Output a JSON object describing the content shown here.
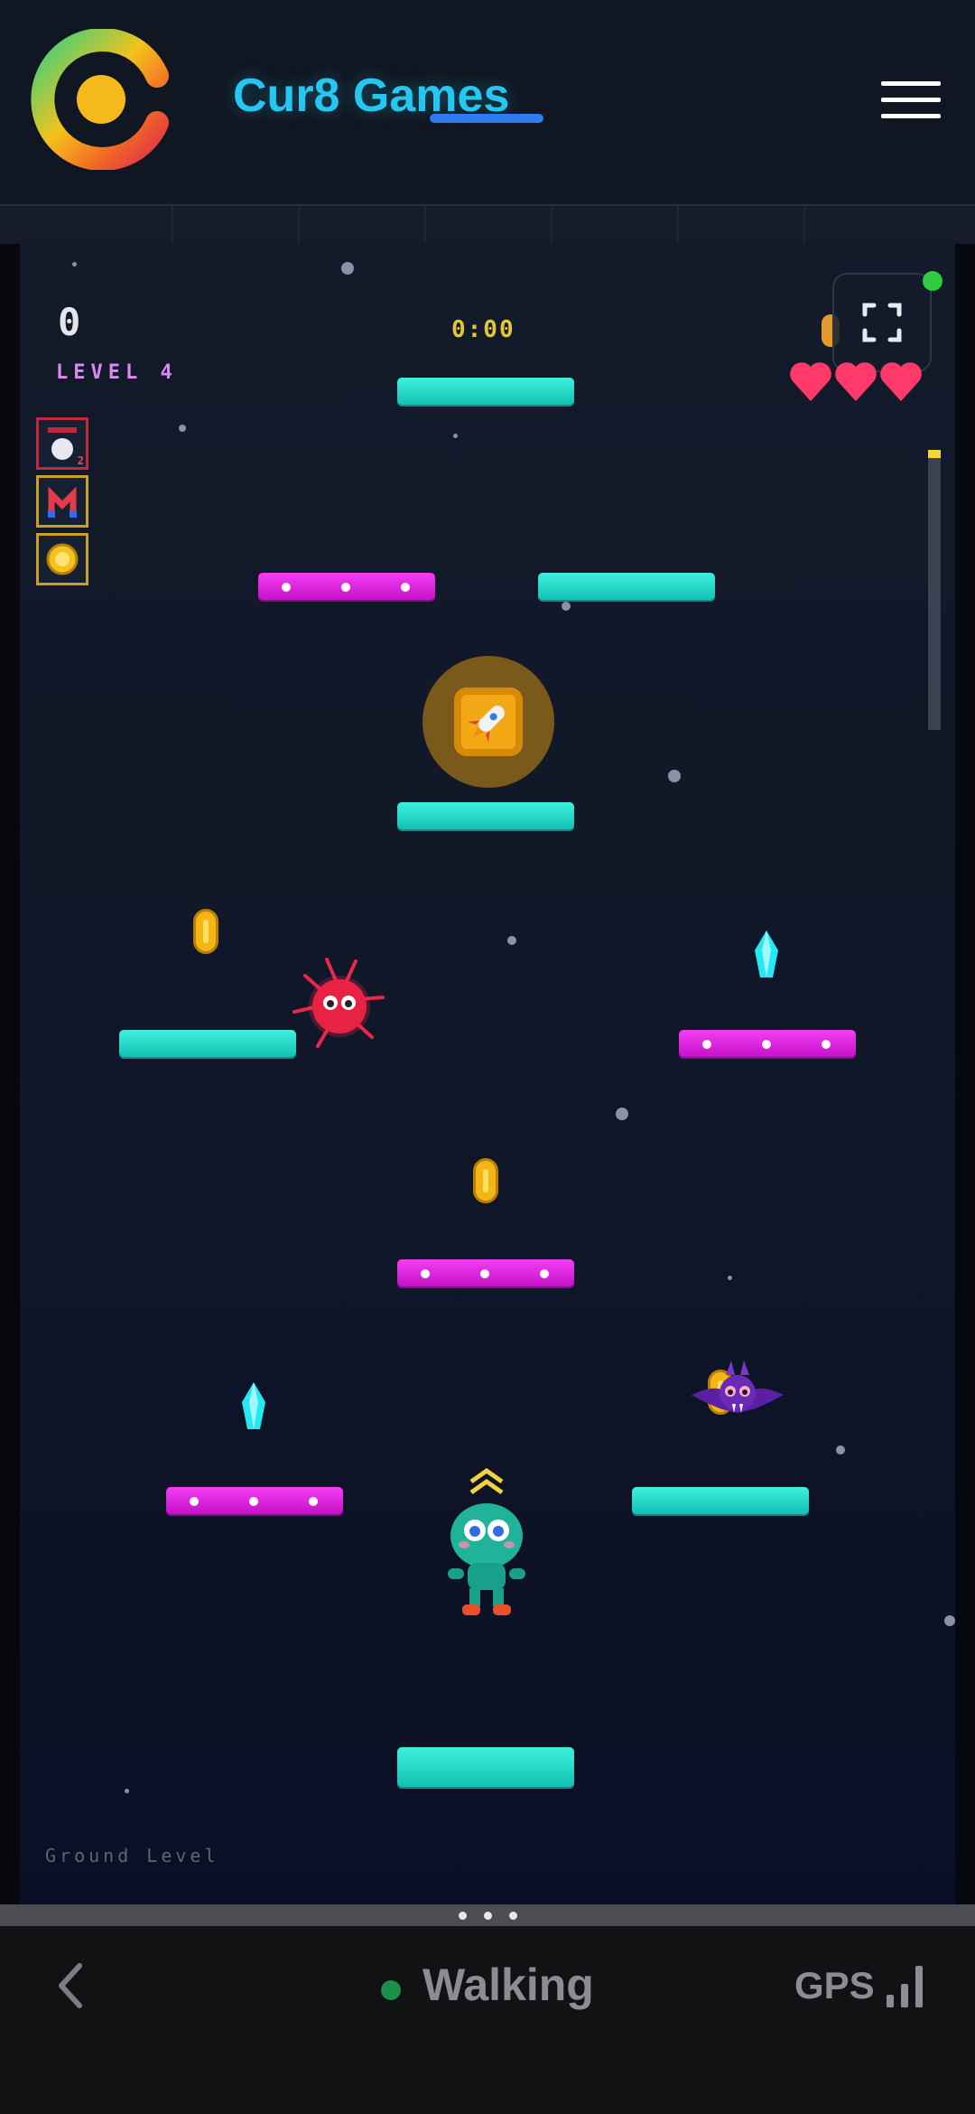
{
  "header": {
    "brand": "Cur8 Games",
    "menu_icon": "hamburger-menu-icon"
  },
  "game": {
    "score": "0",
    "level_label": "LEVEL 4",
    "timer": "0:00",
    "lives": 3,
    "ground_label": "Ground Level",
    "powerups": [
      {
        "name": "shield-powerup",
        "count": "2"
      },
      {
        "name": "magnet-powerup",
        "count": ""
      },
      {
        "name": "coin-multiplier-powerup",
        "count": ""
      }
    ],
    "level_progress": 0.03
  },
  "colors": {
    "brand": "#25c7f0",
    "platform_cyan": "#12c1b3",
    "platform_magenta": "#c412c8",
    "timer": "#e8c43a",
    "hearts": "#ff3a6a"
  },
  "bottom_bar": {
    "status": "Walking",
    "gps_label": "GPS"
  }
}
